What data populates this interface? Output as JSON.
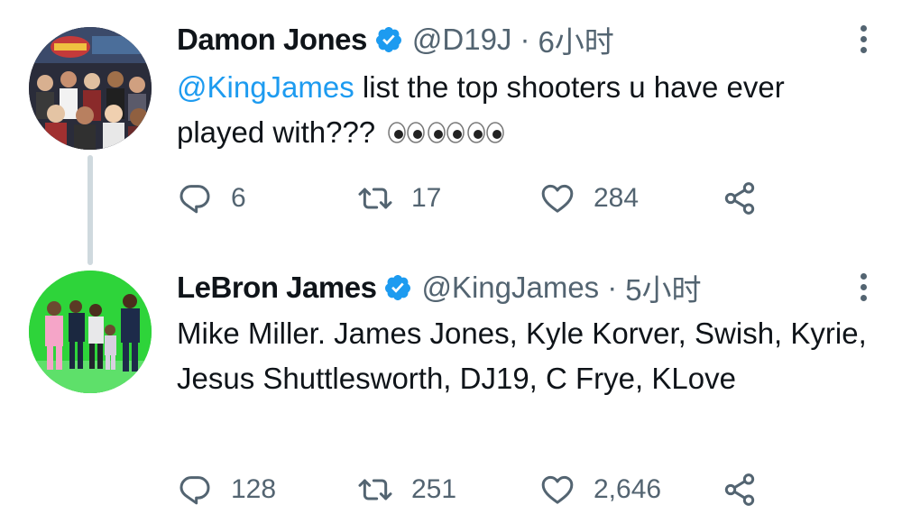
{
  "tweets": [
    {
      "name": "Damon Jones",
      "handle": "@D19J",
      "separator": "·",
      "time": "6小时",
      "mention": "@KingJames",
      "text": " list the top shooters u have ever played with??? ",
      "emoji": "👀👀👀",
      "replies": "6",
      "retweets": "17",
      "likes": "284"
    },
    {
      "name": "LeBron James",
      "handle": "@KingJames",
      "separator": "·",
      "time": "5小时",
      "text": "Mike Miller. James Jones, Kyle Korver, Swish, Kyrie, Jesus Shuttlesworth, DJ19, C Frye, KLove",
      "replies": "128",
      "retweets": "251",
      "likes": "2,646"
    }
  ],
  "colors": {
    "verified": "#1d9bf0",
    "mention": "#1d9bf0",
    "muted": "#536471",
    "thread_line": "#cfd9de"
  },
  "icons": [
    "verified-badge-icon",
    "more-icon",
    "reply-icon",
    "retweet-icon",
    "like-icon",
    "share-icon"
  ]
}
